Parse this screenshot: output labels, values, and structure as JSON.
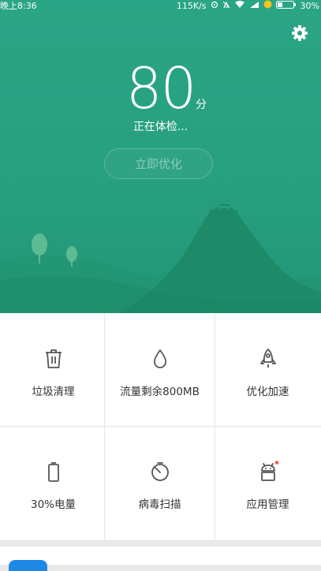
{
  "status_bar": {
    "time": "晚上8:36",
    "speed": "115K/s",
    "battery": "30%"
  },
  "header": {
    "settings_icon": "gear-icon",
    "score": "80",
    "score_unit": "分",
    "status": "正在体检...",
    "optimize_button": "立即优化"
  },
  "tools": [
    {
      "label": "垃圾清理",
      "icon": "trash-icon"
    },
    {
      "label": "流量剩余800MB",
      "icon": "droplet-icon"
    },
    {
      "label": "优化加速",
      "icon": "rocket-icon"
    },
    {
      "label": "30%电量",
      "icon": "battery-icon"
    },
    {
      "label": "病毒扫描",
      "icon": "scan-icon"
    },
    {
      "label": "应用管理",
      "icon": "android-icon",
      "badge": true
    }
  ],
  "colors": {
    "primary": "#27a07f",
    "badge": "#e8624a",
    "icon": "#555555"
  }
}
